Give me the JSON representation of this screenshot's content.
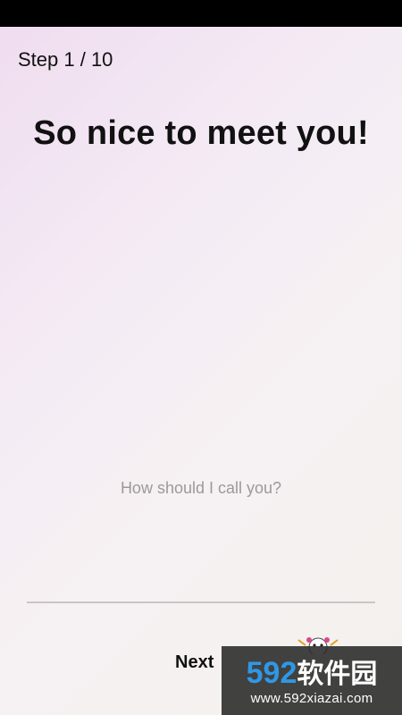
{
  "header": {
    "step_label": "Step 1 / 10",
    "title": "So nice to meet you!"
  },
  "form": {
    "name_value": "",
    "name_placeholder": "How should I call you?"
  },
  "footer": {
    "next_label": "Next",
    "mascot_icon": "mascot-icon"
  },
  "watermark": {
    "brand_number": "592",
    "brand_text": "软件园",
    "url": "www.592xiazai.com"
  },
  "colors": {
    "background_start": "#efdcef",
    "background_end": "#f3f1ec",
    "input_underline": "#c8c6c6",
    "watermark_blue": "#2f98e6"
  }
}
